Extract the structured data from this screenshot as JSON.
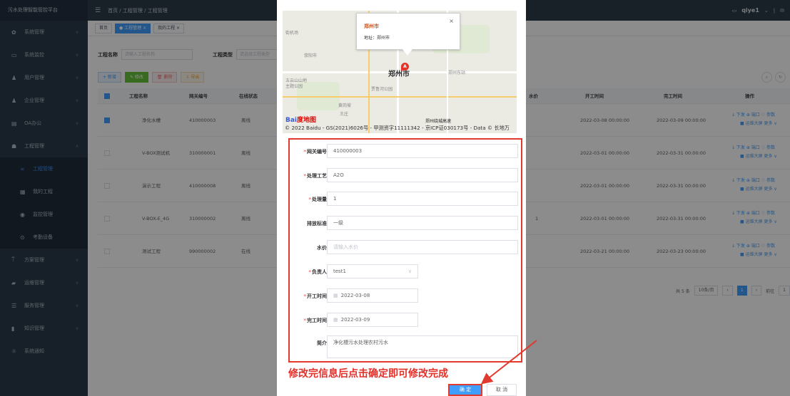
{
  "app": {
    "title": "污水处理智能管控平台"
  },
  "sidebar": {
    "items": [
      {
        "label": "系统管理",
        "icon": "gear-icon"
      },
      {
        "label": "系统监控",
        "icon": "monitor-icon"
      },
      {
        "label": "用户管理",
        "icon": "user-icon"
      },
      {
        "label": "企业管理",
        "icon": "company-icon"
      },
      {
        "label": "OA办公",
        "icon": "office-icon"
      },
      {
        "label": "工程管理",
        "icon": "project-icon"
      },
      {
        "label": "工程管理",
        "icon": "link-icon"
      },
      {
        "label": "我的工程",
        "icon": "grid-icon"
      },
      {
        "label": "监控管理",
        "icon": "eye-icon"
      },
      {
        "label": "考勤设备",
        "icon": "device-icon"
      },
      {
        "label": "方案管理",
        "icon": "scheme-icon"
      },
      {
        "label": "运维管理",
        "icon": "ops-icon"
      },
      {
        "label": "服务管理",
        "icon": "service-icon"
      },
      {
        "label": "知识管理",
        "icon": "book-icon"
      },
      {
        "label": "系统通知",
        "icon": "bell-icon"
      }
    ]
  },
  "topbar": {
    "breadcrumb": "首页 / 工程管理 / 工程管理",
    "username": "qiye1"
  },
  "tabs": [
    {
      "label": "首页"
    },
    {
      "label": "● 工程管理 ×"
    },
    {
      "label": "我的工程 ×"
    }
  ],
  "search": {
    "name_label": "工程名称",
    "name_placeholder": "请输入工程名称",
    "type_label": "工程类型",
    "type_placeholder": "请选择工程类型"
  },
  "toolbar": {
    "add": "+ 新增",
    "edit": "✎ 修改",
    "del": "🗑 删除",
    "export": "⇩ 导出"
  },
  "table": {
    "headers": [
      "工程名称",
      "网关编号",
      "在线状态",
      "水价",
      "开工时间",
      "完工时间",
      "操作"
    ],
    "rows": [
      {
        "name": "净化水槽",
        "gateway": "410000003",
        "status": "离线",
        "price": "",
        "start": "2022-03-08 00:00:00",
        "end": "2022-03-09 00:00:00",
        "checked": true
      },
      {
        "name": "V-BOX测试机",
        "gateway": "310000001",
        "status": "离线",
        "price": "",
        "start": "2022-03-01 00:00:00",
        "end": "2022-03-31 00:00:00",
        "checked": false
      },
      {
        "name": "演示工程",
        "gateway": "410000008",
        "status": "离线",
        "price": "",
        "start": "2022-03-01 00:00:00",
        "end": "2022-03-31 00:00:00",
        "checked": false
      },
      {
        "name": "V-BOX-E_4G",
        "gateway": "310000002",
        "status": "离线",
        "price": "1",
        "start": "2022-03-01 00:00:00",
        "end": "2022-03-31 00:00:00",
        "checked": false
      },
      {
        "name": "测试工程",
        "gateway": "990000002",
        "status": "在线",
        "price": "",
        "start": "2022-03-21 00:00:00",
        "end": "2022-03-23 00:00:00",
        "checked": false
      }
    ],
    "ops_line1": "↓ 下发  ⊕ 端口  ♡ 参数",
    "ops_line2": "■ 运维大屏  更多 ∨"
  },
  "pager": {
    "total": "共 5 条",
    "size": "10条/页",
    "page": "1",
    "goto": "前往",
    "goto_val": "1"
  },
  "map": {
    "popup_title": "郑州市",
    "popup_addr": "地址：郑州市",
    "city": "郑州市",
    "marker": "A",
    "labels": [
      "街机场",
      "荥阳市",
      "郑州东站",
      "五云山山地",
      "主题公园",
      "贾鲁河公园",
      "郑州绕城高速",
      "黄岗坡",
      "王庄"
    ],
    "baidu": "Bai",
    "baidu_mark": "度地图",
    "copyright": "© 2022 Baidu - GS(2021)6026号 - 甲测资字11111342 - 京ICP证030173号 - Data © 长地万"
  },
  "form": {
    "gateway_label": "网关编号",
    "gateway_val": "410000003",
    "process_label": "处理工艺",
    "process_val": "A2O",
    "volume_label": "处理量",
    "volume_val": "1",
    "standard_label": "排放标准",
    "standard_val": "一级",
    "price_label": "水价",
    "price_placeholder": "请输入水价",
    "owner_label": "负责人",
    "owner_val": "test1",
    "start_label": "开工时间",
    "start_val": "2022-03-08",
    "end_label": "完工时间",
    "end_val": "2022-03-09",
    "intro_label": "简介",
    "intro_val": "净化槽污水处理农村污水"
  },
  "note": "修改完信息后点击确定即可修改完成",
  "buttons": {
    "ok": "确 定",
    "cancel": "取 消"
  },
  "colors": {
    "primary": "#409eff",
    "annotation": "#e03a2e",
    "sidebar": "#2a3a4a"
  }
}
